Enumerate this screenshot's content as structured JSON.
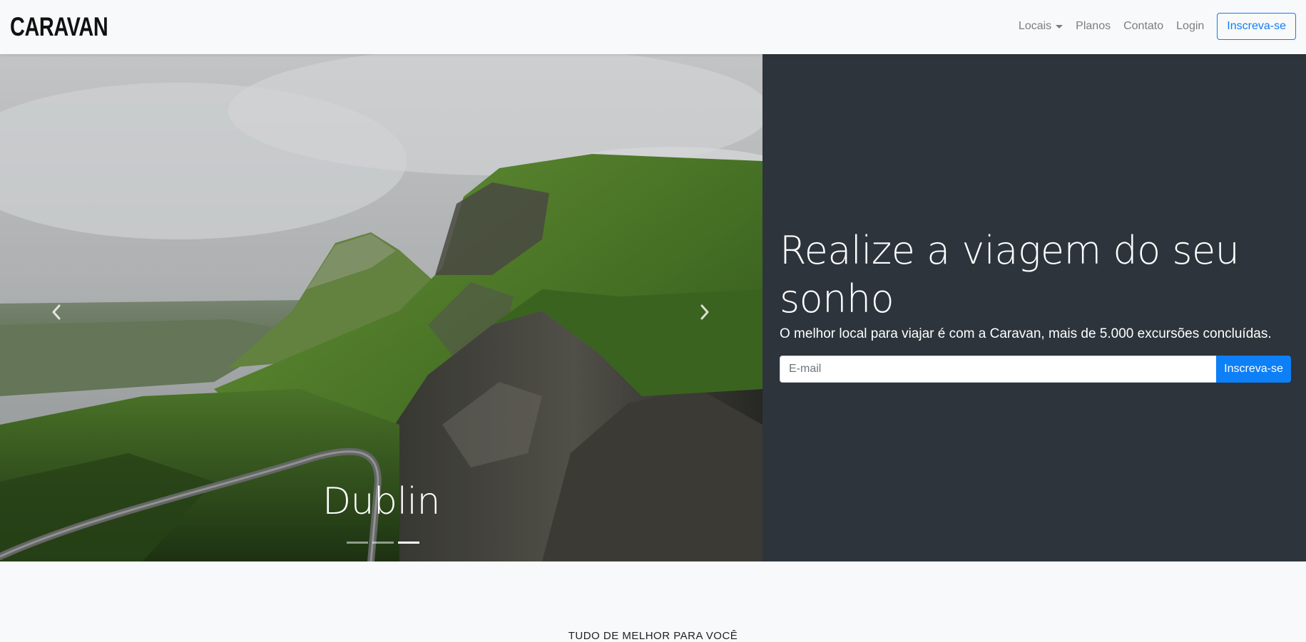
{
  "navbar": {
    "brand": "CARAVAN",
    "links": [
      {
        "label": "Locais",
        "has_dropdown": true
      },
      {
        "label": "Planos"
      },
      {
        "label": "Contato"
      },
      {
        "label": "Login"
      }
    ],
    "cta_label": "Inscreva-se"
  },
  "hero": {
    "carousel": {
      "caption": "Dublin",
      "indicator_count": 3,
      "active_index": 2,
      "prev_icon": "chevron-left-icon",
      "next_icon": "chevron-right-icon"
    },
    "title": "Realize a viagem do seu sonho",
    "subtitle": "O melhor local para viajar é com a Caravan, mais de 5.000 excursões concluídas.",
    "email_placeholder": "E-mail",
    "submit_label": "Inscreva-se"
  },
  "section": {
    "title": "TUDO DE MELHOR PARA VOCÊ"
  },
  "colors": {
    "accent": "#0d7ff7",
    "hero_panel": "#2d343c",
    "page_bg": "#f8f9fa"
  }
}
